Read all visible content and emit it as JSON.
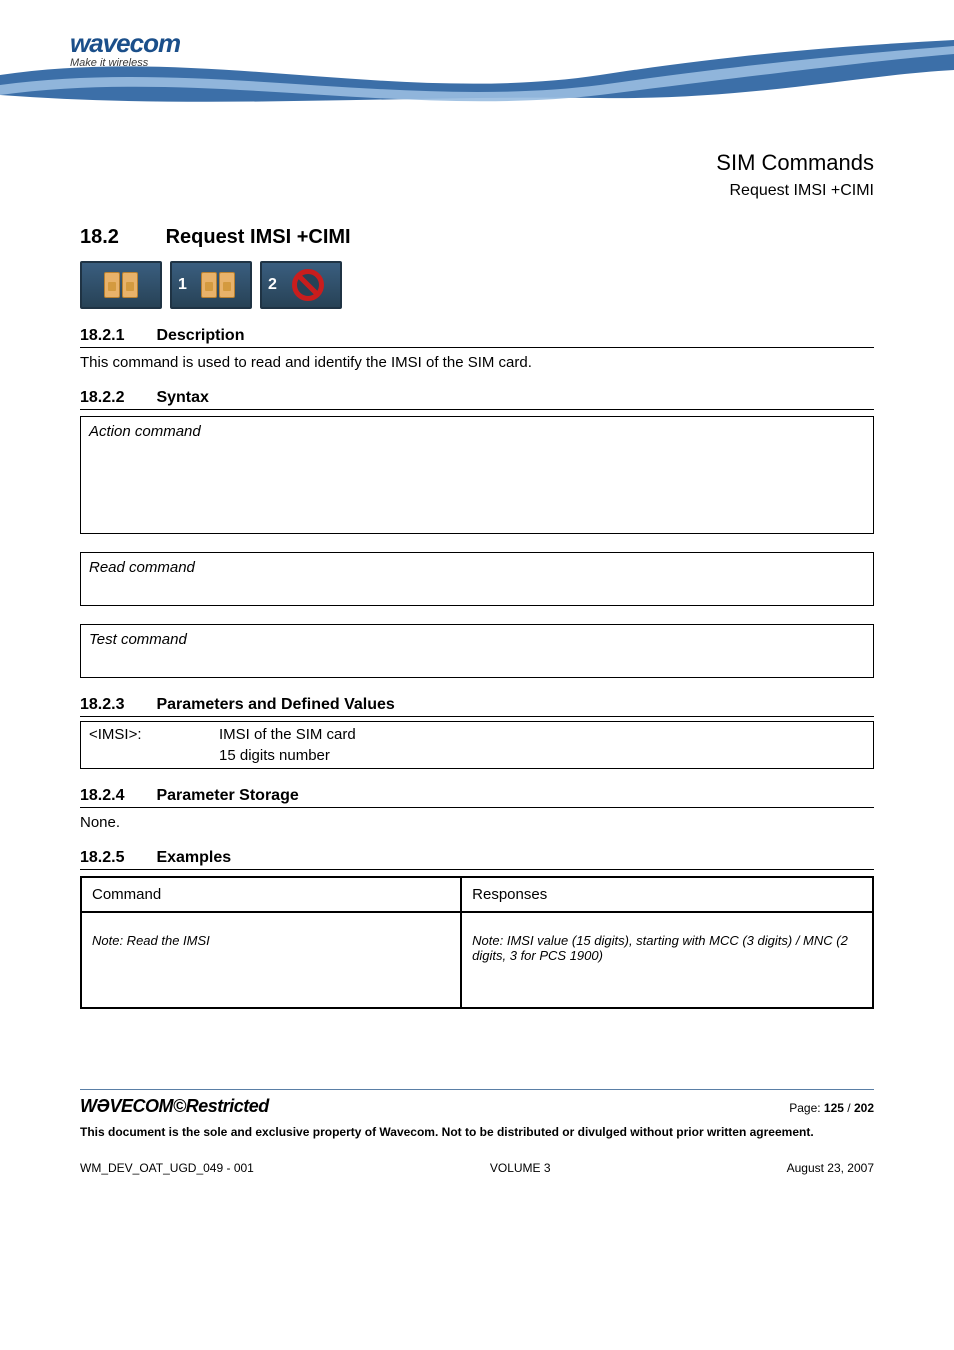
{
  "logo": {
    "brand": "wavecom",
    "tagline": "Make it wireless"
  },
  "header": {
    "title1": "SIM Commands",
    "title2": "Request IMSI +CIMI"
  },
  "section": {
    "num": "18.2",
    "title": "Request IMSI +CIMI"
  },
  "icons": {
    "badge2": "1",
    "badge3": "2"
  },
  "sub1": {
    "num": "18.2.1",
    "title": "Description"
  },
  "desc_text": "This command is used to read and identify the IMSI of the SIM card.",
  "sub2": {
    "num": "18.2.2",
    "title": "Syntax"
  },
  "syntax": {
    "action_label": "Action command",
    "read_label": "Read command",
    "test_label": "Test command"
  },
  "sub3": {
    "num": "18.2.3",
    "title": "Parameters and Defined Values"
  },
  "params": {
    "key": "<IMSI>:",
    "line1": "IMSI of the SIM card",
    "line2": "15 digits number"
  },
  "sub4": {
    "num": "18.2.4",
    "title": "Parameter Storage"
  },
  "storage_text": "None.",
  "sub5": {
    "num": "18.2.5",
    "title": "Examples"
  },
  "examples": {
    "col1": "Command",
    "col2": "Responses",
    "row1_left_note": "Note: Read the IMSI",
    "row1_right_note": "Note: IMSI value (15 digits), starting with MCC (3 digits) / MNC (2 digits, 3 for PCS 1900)"
  },
  "footer": {
    "logo": "WƏVECOM",
    "copy": "©Restricted",
    "page_label": "Page: ",
    "page_cur": "125",
    "page_sep": " / ",
    "page_total": "202",
    "disclaimer": "This document is the sole and exclusive property of Wavecom. Not to be distributed or divulged without prior written agreement.",
    "docid": "WM_DEV_OAT_UGD_049 - 001",
    "volume": "VOLUME 3",
    "date": "August 23, 2007"
  }
}
